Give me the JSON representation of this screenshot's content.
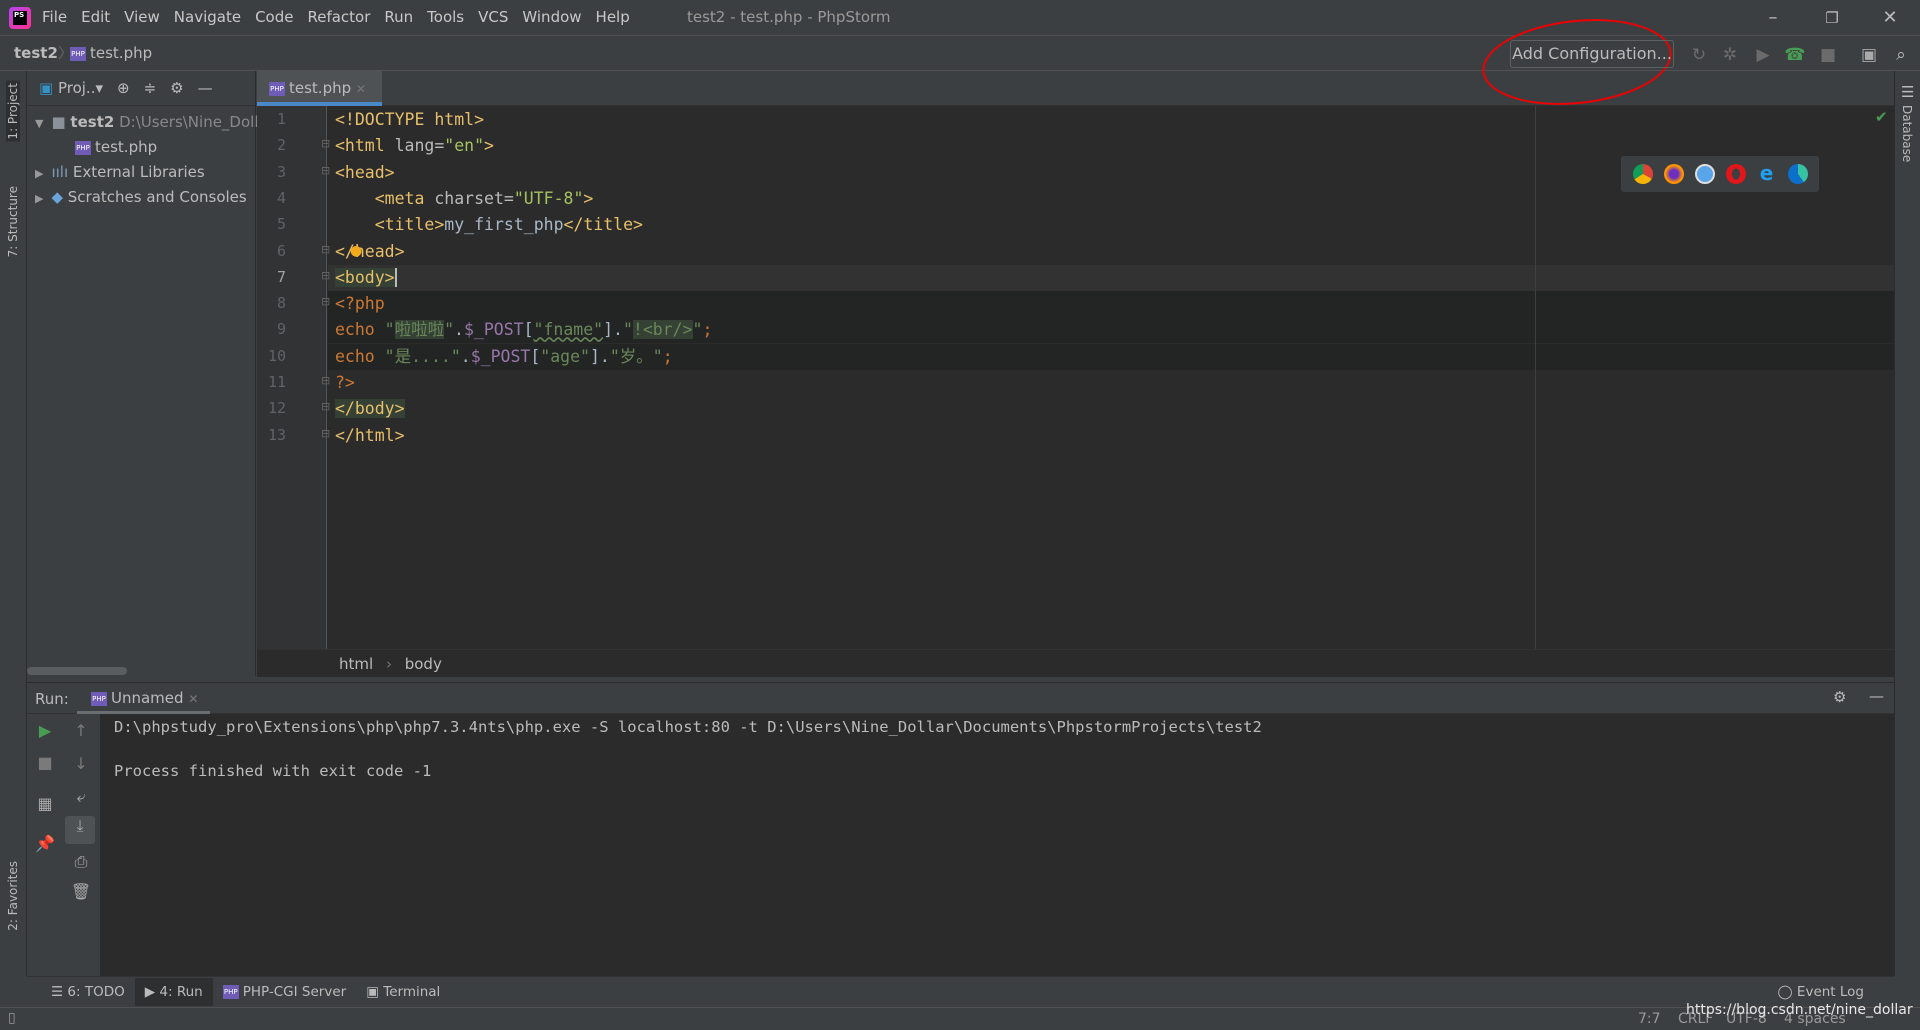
{
  "window": {
    "title": "test2 - test.php - PhpStorm",
    "logo": "PS"
  },
  "menu": [
    "File",
    "Edit",
    "View",
    "Navigate",
    "Code",
    "Refactor",
    "Run",
    "Tools",
    "VCS",
    "Window",
    "Help"
  ],
  "navbar": {
    "project": "test2",
    "file": "test.php",
    "add_config": "Add Configuration..."
  },
  "left_stripe": {
    "project": "1: Project",
    "structure": "7: Structure",
    "favorites": "2: Favorites"
  },
  "right_stripe": {
    "database": "Database"
  },
  "project_panel": {
    "dropdown": "Proj..",
    "tree": [
      {
        "label": "test2",
        "path": "D:\\Users\\Nine_Doll",
        "level": 0,
        "expanded": true
      },
      {
        "label": "test.php",
        "level": 1
      },
      {
        "label": "External Libraries",
        "level": 0
      },
      {
        "label": "Scratches and Consoles",
        "level": 0
      }
    ]
  },
  "editor": {
    "tab": "test.php",
    "current_line": 7,
    "lines": [
      [
        [
          "tag",
          "<!DOCTYPE html>"
        ]
      ],
      [
        [
          "tag",
          "<html "
        ],
        [
          "attr",
          "lang="
        ],
        [
          "val",
          "\"en\""
        ],
        [
          "tag",
          ">"
        ]
      ],
      [
        [
          "tag",
          "<head>"
        ]
      ],
      [
        [
          "txt",
          "    "
        ],
        [
          "tag",
          "<meta "
        ],
        [
          "attr",
          "charset="
        ],
        [
          "val",
          "\"UTF-8\""
        ],
        [
          "tag",
          ">"
        ]
      ],
      [
        [
          "txt",
          "    "
        ],
        [
          "tag",
          "<title>"
        ],
        [
          "txt",
          "my_first_php"
        ],
        [
          "tag",
          "</title>"
        ]
      ],
      [
        [
          "tag",
          "</head>"
        ]
      ],
      [
        [
          "tag hl",
          "<body>"
        ]
      ],
      [
        [
          "kw",
          "<?php"
        ]
      ],
      [
        [
          "kw",
          "echo "
        ],
        [
          "str",
          "\""
        ],
        [
          "strhl",
          "啦啦啦"
        ],
        [
          "str",
          "\""
        ],
        [
          "txt",
          "."
        ],
        [
          "var",
          "$_POST"
        ],
        [
          "txt",
          "["
        ],
        [
          "str",
          "\"fname\""
        ],
        [
          "txt",
          "]."
        ],
        [
          "str",
          "\""
        ],
        [
          "strhl",
          "!<br/>"
        ],
        [
          "str",
          "\""
        ],
        [
          "kw",
          ";"
        ]
      ],
      [
        [
          "kw",
          "echo "
        ],
        [
          "str",
          "\"是....\""
        ],
        [
          "txt",
          "."
        ],
        [
          "var",
          "$_POST"
        ],
        [
          "txt",
          "["
        ],
        [
          "str",
          "\"age\""
        ],
        [
          "txt",
          "]."
        ],
        [
          "str",
          "\"岁。\""
        ],
        [
          "kw",
          ";"
        ]
      ],
      [
        [
          "kw",
          "?>"
        ]
      ],
      [
        [
          "tag hl",
          "</body>"
        ]
      ],
      [
        [
          "tag",
          "</html>"
        ]
      ]
    ],
    "breadcrumb": [
      "html",
      "body"
    ]
  },
  "run": {
    "label": "Run:",
    "tab": "Unnamed",
    "output": [
      "D:\\phpstudy_pro\\Extensions\\php\\php7.3.4nts\\php.exe -S localhost:80 -t D:\\Users\\Nine_Dollar\\Documents\\PhpstormProjects\\test2",
      "",
      "Process finished with exit code -1"
    ]
  },
  "bottom_tabs": [
    "6: TODO",
    "4: Run",
    "PHP-CGI Server",
    "Terminal"
  ],
  "event_log": "Event Log",
  "status": {
    "position": "7:7",
    "line_sep": "CRLF",
    "encoding": "UTF-8",
    "indent": "4 spaces",
    "watermark": "https://blog.csdn.net/nine_dollar"
  },
  "colors": {
    "accent": "#4a88c7",
    "annotation": "#e00000"
  }
}
